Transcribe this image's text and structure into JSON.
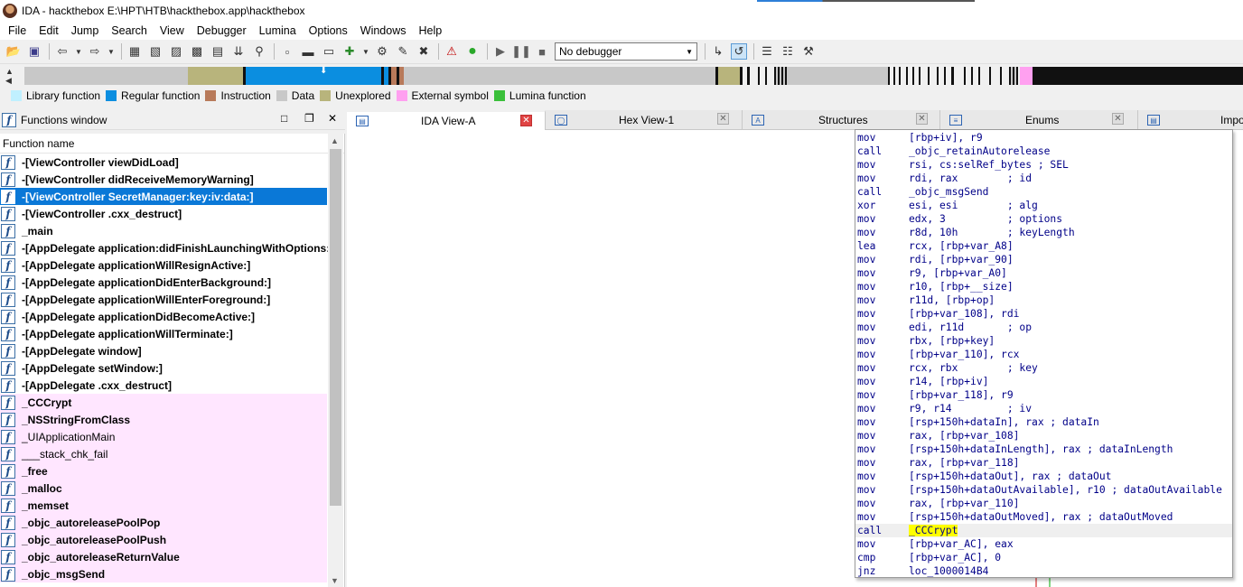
{
  "window": {
    "title": "IDA - hackthebox E:\\HPT\\HTB\\hackthebox.app\\hackthebox"
  },
  "menu": [
    "File",
    "Edit",
    "Jump",
    "Search",
    "View",
    "Debugger",
    "Lumina",
    "Options",
    "Windows",
    "Help"
  ],
  "toolbar": {
    "debugger_select": "No debugger"
  },
  "legend": [
    {
      "label": "Library function",
      "color": "#c0f0ff"
    },
    {
      "label": "Regular function",
      "color": "#0b8ee0"
    },
    {
      "label": "Instruction",
      "color": "#b87a5a"
    },
    {
      "label": "Data",
      "color": "#c8c8c8"
    },
    {
      "label": "Unexplored",
      "color": "#b8b47c"
    },
    {
      "label": "External symbol",
      "color": "#ffa0f0"
    },
    {
      "label": "Lumina function",
      "color": "#3ac03a"
    }
  ],
  "functions_window": {
    "title": "Functions window",
    "column": "Function name",
    "items": [
      {
        "name": "-[ViewController viewDidLoad]",
        "kind": "regular"
      },
      {
        "name": "-[ViewController didReceiveMemoryWarning]",
        "kind": "regular"
      },
      {
        "name": "-[ViewController SecretManager:key:iv:data:]",
        "kind": "selected"
      },
      {
        "name": "-[ViewController .cxx_destruct]",
        "kind": "regular"
      },
      {
        "name": "_main",
        "kind": "regular"
      },
      {
        "name": "-[AppDelegate application:didFinishLaunchingWithOptions:]",
        "kind": "regular"
      },
      {
        "name": "-[AppDelegate applicationWillResignActive:]",
        "kind": "regular"
      },
      {
        "name": "-[AppDelegate applicationDidEnterBackground:]",
        "kind": "regular"
      },
      {
        "name": "-[AppDelegate applicationWillEnterForeground:]",
        "kind": "regular"
      },
      {
        "name": "-[AppDelegate applicationDidBecomeActive:]",
        "kind": "regular"
      },
      {
        "name": "-[AppDelegate applicationWillTerminate:]",
        "kind": "regular"
      },
      {
        "name": "-[AppDelegate window]",
        "kind": "regular"
      },
      {
        "name": "-[AppDelegate setWindow:]",
        "kind": "regular"
      },
      {
        "name": "-[AppDelegate .cxx_destruct]",
        "kind": "regular"
      },
      {
        "name": "_CCCrypt",
        "kind": "external"
      },
      {
        "name": "_NSStringFromClass",
        "kind": "external"
      },
      {
        "name": "_UIApplicationMain",
        "kind": "external-normal"
      },
      {
        "name": "___stack_chk_fail",
        "kind": "external-normal"
      },
      {
        "name": "_free",
        "kind": "external"
      },
      {
        "name": "_malloc",
        "kind": "external"
      },
      {
        "name": "_memset",
        "kind": "external"
      },
      {
        "name": "_objc_autoreleasePoolPop",
        "kind": "external"
      },
      {
        "name": "_objc_autoreleasePoolPush",
        "kind": "external"
      },
      {
        "name": "_objc_autoreleaseReturnValue",
        "kind": "external"
      },
      {
        "name": "_objc_msgSend",
        "kind": "external"
      }
    ]
  },
  "tabs": [
    {
      "label": "IDA View-A",
      "active": true
    },
    {
      "label": "Hex View-1",
      "active": false
    },
    {
      "label": "Structures",
      "active": false
    },
    {
      "label": "Enums",
      "active": false
    },
    {
      "label": "Impo",
      "active": false
    }
  ],
  "disassembly": [
    {
      "mnemonic": "mov",
      "operands": "[rbp+iv], r9"
    },
    {
      "mnemonic": "call",
      "operands": "_objc_retainAutorelease"
    },
    {
      "mnemonic": "mov",
      "operands": "rsi, cs:selRef_bytes ; SEL"
    },
    {
      "mnemonic": "mov",
      "operands": "rdi, rax        ; id"
    },
    {
      "mnemonic": "call",
      "operands": "_objc_msgSend"
    },
    {
      "mnemonic": "xor",
      "operands": "esi, esi        ; alg"
    },
    {
      "mnemonic": "mov",
      "operands": "edx, 3          ; options"
    },
    {
      "mnemonic": "mov",
      "operands": "r8d, 10h        ; keyLength"
    },
    {
      "mnemonic": "lea",
      "operands": "rcx, [rbp+var_A8]"
    },
    {
      "mnemonic": "mov",
      "operands": "rdi, [rbp+var_90]"
    },
    {
      "mnemonic": "mov",
      "operands": "r9, [rbp+var_A0]"
    },
    {
      "mnemonic": "mov",
      "operands": "r10, [rbp+__size]"
    },
    {
      "mnemonic": "mov",
      "operands": "r11d, [rbp+op]"
    },
    {
      "mnemonic": "mov",
      "operands": "[rbp+var_108], rdi"
    },
    {
      "mnemonic": "mov",
      "operands": "edi, r11d       ; op"
    },
    {
      "mnemonic": "mov",
      "operands": "rbx, [rbp+key]"
    },
    {
      "mnemonic": "mov",
      "operands": "[rbp+var_110], rcx"
    },
    {
      "mnemonic": "mov",
      "operands": "rcx, rbx        ; key"
    },
    {
      "mnemonic": "mov",
      "operands": "r14, [rbp+iv]"
    },
    {
      "mnemonic": "mov",
      "operands": "[rbp+var_118], r9"
    },
    {
      "mnemonic": "mov",
      "operands": "r9, r14         ; iv"
    },
    {
      "mnemonic": "mov",
      "operands": "[rsp+150h+dataIn], rax ; dataIn"
    },
    {
      "mnemonic": "mov",
      "operands": "rax, [rbp+var_108]"
    },
    {
      "mnemonic": "mov",
      "operands": "[rsp+150h+dataInLength], rax ; dataInLength"
    },
    {
      "mnemonic": "mov",
      "operands": "rax, [rbp+var_118]"
    },
    {
      "mnemonic": "mov",
      "operands": "[rsp+150h+dataOut], rax ; dataOut"
    },
    {
      "mnemonic": "mov",
      "operands": "[rsp+150h+dataOutAvailable], r10 ; dataOutAvailable"
    },
    {
      "mnemonic": "mov",
      "operands": "rax, [rbp+var_110]"
    },
    {
      "mnemonic": "mov",
      "operands": "[rsp+150h+dataOutMoved], rax ; dataOutMoved"
    },
    {
      "mnemonic": "call",
      "operands": "_CCCrypt",
      "current": true
    },
    {
      "mnemonic": "mov",
      "operands": "[rbp+var_AC], eax"
    },
    {
      "mnemonic": "cmp",
      "operands": "[rbp+var_AC], 0"
    },
    {
      "mnemonic": "jnz",
      "operands": "loc_1000014B4"
    }
  ]
}
